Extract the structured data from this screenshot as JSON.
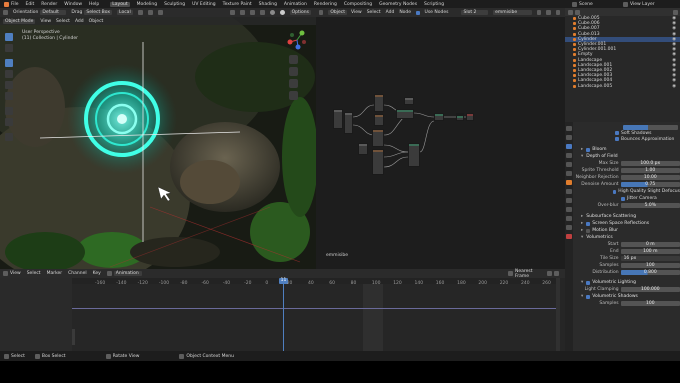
{
  "topbar": {
    "menu": [
      "File",
      "Edit",
      "Render",
      "Window",
      "Help"
    ],
    "workspaces": [
      "Layout",
      "Modeling",
      "Sculpting",
      "UV Editing",
      "Texture Paint",
      "Shading",
      "Animation",
      "Rendering",
      "Compositing",
      "Geometry Nodes",
      "Scripting"
    ],
    "active_workspace": "Layout",
    "scene": "Scene",
    "view_layer": "View Layer"
  },
  "viewport_header": {
    "orientation_label": "Orientation",
    "orientation_value": "Default",
    "drag_label": "Drag",
    "drag_value": "Select Box",
    "transform": "Local",
    "options": "Options",
    "mode": "Object Mode",
    "menus": [
      "View",
      "Select",
      "Add",
      "Object"
    ]
  },
  "viewport": {
    "title": "User Perspective",
    "subtitle": "(11) Collection | Cylinder"
  },
  "node_header": {
    "type": "Object",
    "menus": [
      "View",
      "Select",
      "Add",
      "Node"
    ],
    "use_nodes": "Use Nodes",
    "slot": "Slot 2",
    "material": "emmisibe"
  },
  "node_editor": {
    "material_label": "emmisibe"
  },
  "outliner": {
    "items": [
      {
        "name": "Cube.005",
        "selected": false
      },
      {
        "name": "Cube.006",
        "selected": false
      },
      {
        "name": "Cube.007",
        "selected": false
      },
      {
        "name": "Cube.013",
        "selected": false
      },
      {
        "name": "Cylinder",
        "selected": true
      },
      {
        "name": "Cylinder.001",
        "selected": false
      },
      {
        "name": "Cylinder.001.001",
        "selected": false
      },
      {
        "name": "Empty",
        "selected": false
      },
      {
        "name": "Landscape",
        "selected": false
      },
      {
        "name": "Landscape.001",
        "selected": false
      },
      {
        "name": "Landscape.002",
        "selected": false
      },
      {
        "name": "Landscape.003",
        "selected": false
      },
      {
        "name": "Landscape.004",
        "selected": false
      },
      {
        "name": "Landscape.005",
        "selected": false
      }
    ]
  },
  "properties": {
    "checks_top": [
      "Soft Shadows",
      "Bounces Approximation"
    ],
    "bloom": {
      "label": "Bloom",
      "dof_label": "Depth of Field",
      "rows": [
        {
          "label": "Max Size",
          "value": "100.0 px"
        },
        {
          "label": "Sprite Threshold",
          "value": "1.00"
        },
        {
          "label": "Neighbor Rejection",
          "value": "10.00"
        },
        {
          "label": "Denoise Amount",
          "value": "0.75"
        }
      ],
      "checks": [
        "High Quality Slight Defocus",
        "Jitter Camera"
      ],
      "overblur_label": "Over-blur",
      "overblur_value": "5.0%"
    },
    "sss_label": "Subsurface Scattering",
    "ssr_label": "Screen Space Reflections",
    "motion_blur_label": "Motion Blur",
    "volumetrics": {
      "label": "Volumetrics",
      "rows": [
        {
          "label": "Start",
          "value": "0 m"
        },
        {
          "label": "End",
          "value": "100 m"
        },
        {
          "label": "Tile Size",
          "value": "16 px"
        },
        {
          "label": "Samples",
          "value": "100"
        },
        {
          "label": "Distribution",
          "value": "0.800"
        }
      ],
      "lighting_label": "Volumetric Lighting",
      "clamping_label": "Light Clamping",
      "clamping_value": "100.000",
      "shadows_label": "Volumetric Shadows",
      "samples_label": "Samples",
      "samples_value": "100"
    }
  },
  "timeline": {
    "menus": [
      "View",
      "Select",
      "Marker",
      "Channel",
      "Key"
    ],
    "mode": "Dope Sheet",
    "mode_value": "Animation",
    "nearest": "Nearest Frame",
    "current_frame": "11",
    "ticks": [
      "-160",
      "-140",
      "-120",
      "-100",
      "-80",
      "-60",
      "-40",
      "-20",
      "0",
      "20",
      "40",
      "60",
      "80",
      "100",
      "120",
      "140",
      "160",
      "180",
      "200",
      "220",
      "240",
      "260"
    ]
  },
  "statusbar": {
    "items": [
      "Select",
      "Box Select",
      "Rotate View",
      "Object Context Menu"
    ]
  },
  "colors": {
    "accent": "#4777b7",
    "glow": "#1fffd8",
    "selection": "#334d7a"
  }
}
